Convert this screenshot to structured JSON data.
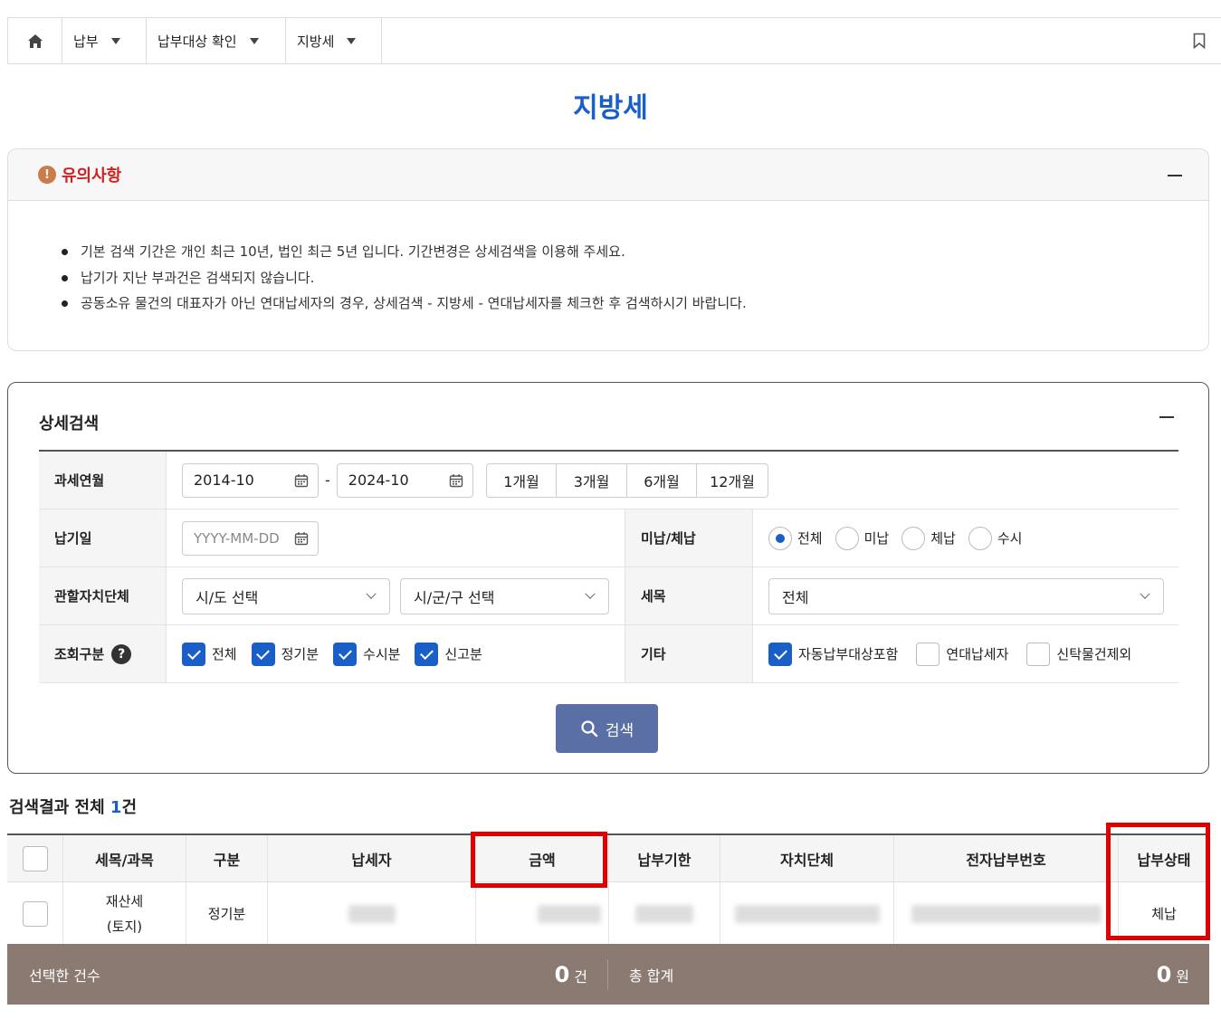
{
  "nav": {
    "items": [
      {
        "label": "납부"
      },
      {
        "label": "납부대상 확인"
      },
      {
        "label": "지방세"
      }
    ]
  },
  "page_title": "지방세",
  "notice": {
    "title": "유의사항",
    "icon_text": "!",
    "items": [
      "기본 검색 기간은 개인 최근 10년, 법인 최근 5년 입니다. 기간변경은 상세검색을 이용해 주세요.",
      "납기가 지난 부과건은 검색되지 않습니다.",
      "공동소유 물건의 대표자가 아닌 연대납세자의 경우, 상세검색 - 지방세 - 연대납세자를 체크한 후 검색하시기 바랍니다."
    ]
  },
  "search": {
    "title": "상세검색",
    "period_label": "과세연월",
    "start_date": "2014-10",
    "end_date": "2024-10",
    "date_sep": "-",
    "range_buttons": [
      "1개월",
      "3개월",
      "6개월",
      "12개월"
    ],
    "due_label": "납기일",
    "due_placeholder": "YYYY-MM-DD",
    "unpaid_label": "미납/체납",
    "unpaid_options": [
      {
        "label": "전체",
        "selected": true
      },
      {
        "label": "미납",
        "selected": false
      },
      {
        "label": "체납",
        "selected": false
      },
      {
        "label": "수시",
        "selected": false
      }
    ],
    "gov_label": "관할자치단체",
    "sido_value": "시/도 선택",
    "sigungu_value": "시/군/구 선택",
    "tax_label": "세목",
    "tax_value": "전체",
    "query_label": "조회구분",
    "help_text": "?",
    "query_options": [
      {
        "label": "전체",
        "checked": true
      },
      {
        "label": "정기분",
        "checked": true
      },
      {
        "label": "수시분",
        "checked": true
      },
      {
        "label": "신고분",
        "checked": true
      }
    ],
    "etc_label": "기타",
    "etc_options": [
      {
        "label": "자동납부대상포함",
        "checked": true
      },
      {
        "label": "연대납세자",
        "checked": false
      },
      {
        "label": "신탁물건제외",
        "checked": false
      }
    ],
    "search_button": "검색"
  },
  "results": {
    "title_prefix": "검색결과 전체 ",
    "count": "1",
    "title_suffix": "건",
    "columns": [
      "세목/과목",
      "구분",
      "납세자",
      "금액",
      "납부기한",
      "자치단체",
      "전자납부번호",
      "납부상태"
    ],
    "rows": [
      {
        "tax_line1": "재산세",
        "tax_line2": "(토지)",
        "type": "정기분",
        "status": "체납"
      }
    ]
  },
  "footer": {
    "selected_label": "선택한 건수",
    "selected_count": "0",
    "selected_unit": "건",
    "total_label": "총 합계",
    "total_value": "0",
    "total_unit": "원"
  },
  "colors": {
    "accent": "#1a5fc8",
    "notice_title": "#d32020",
    "search_button": "#5a6fa5",
    "footer_bg": "#8a7a71",
    "highlight": "#e00000"
  }
}
